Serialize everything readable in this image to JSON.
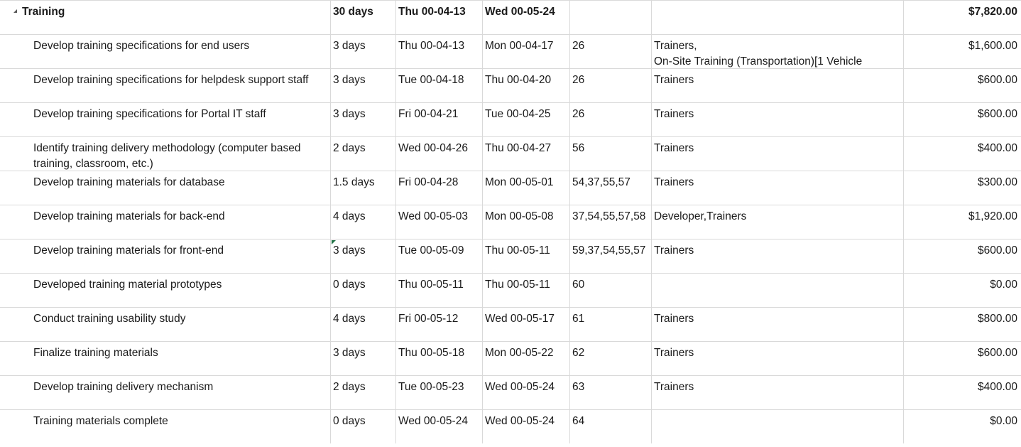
{
  "summary": {
    "name": "Training",
    "duration": "30 days",
    "start": "Thu 00-04-13",
    "finish": "Wed 00-05-24",
    "predecessors": "",
    "resources": [],
    "cost": "$7,820.00"
  },
  "tasks": [
    {
      "name": "Develop training specifications for end users",
      "duration": "3 days",
      "start": "Thu 00-04-13",
      "finish": "Mon 00-04-17",
      "predecessors": "26",
      "resources": [
        "Trainers,",
        "On-Site Training (Transportation)[1 Vehicle"
      ],
      "cost": "$1,600.00"
    },
    {
      "name": "Develop training specifications for helpdesk support staff",
      "duration": "3 days",
      "start": "Tue 00-04-18",
      "finish": "Thu 00-04-20",
      "predecessors": "26",
      "resources": [
        "Trainers"
      ],
      "cost": "$600.00"
    },
    {
      "name": "Develop training specifications for Portal IT staff",
      "duration": "3 days",
      "start": "Fri 00-04-21",
      "finish": "Tue 00-04-25",
      "predecessors": "26",
      "resources": [
        "Trainers"
      ],
      "cost": "$600.00"
    },
    {
      "name": "Identify training delivery methodology (computer based training, classroom, etc.)",
      "duration": "2 days",
      "start": "Wed 00-04-26",
      "finish": "Thu 00-04-27",
      "predecessors": "56",
      "resources": [
        "Trainers"
      ],
      "cost": "$400.00"
    },
    {
      "name": "Develop training materials for database",
      "duration": "1.5 days",
      "start": "Fri 00-04-28",
      "finish": "Mon 00-05-01",
      "predecessors": "54,37,55,57",
      "resources": [
        "Trainers"
      ],
      "cost": "$300.00"
    },
    {
      "name": "Develop training materials for back-end",
      "duration": "4 days",
      "start": "Wed 00-05-03",
      "finish": "Mon 00-05-08",
      "predecessors": "37,54,55,57,58",
      "resources": [
        "Developer,Trainers"
      ],
      "cost": "$1,920.00"
    },
    {
      "name": "Develop training materials for front-end",
      "duration": "3 days",
      "start": "Tue 00-05-09",
      "finish": "Thu 00-05-11",
      "predecessors": "59,37,54,55,57",
      "resources": [
        "Trainers"
      ],
      "cost": "$600.00",
      "edited_marker": true
    },
    {
      "name": "Developed training material prototypes",
      "duration": "0 days",
      "start": "Thu 00-05-11",
      "finish": "Thu 00-05-11",
      "predecessors": "60",
      "resources": [],
      "cost": "$0.00"
    },
    {
      "name": "Conduct training usability study",
      "duration": "4 days",
      "start": "Fri 00-05-12",
      "finish": "Wed 00-05-17",
      "predecessors": "61",
      "resources": [
        "Trainers"
      ],
      "cost": "$800.00"
    },
    {
      "name": "Finalize training materials",
      "duration": "3 days",
      "start": "Thu 00-05-18",
      "finish": "Mon 00-05-22",
      "predecessors": "62",
      "resources": [
        "Trainers"
      ],
      "cost": "$600.00"
    },
    {
      "name": "Develop training delivery mechanism",
      "duration": "2 days",
      "start": "Tue 00-05-23",
      "finish": "Wed 00-05-24",
      "predecessors": "63",
      "resources": [
        "Trainers"
      ],
      "cost": "$400.00"
    },
    {
      "name": "Training materials complete",
      "duration": "0 days",
      "start": "Wed 00-05-24",
      "finish": "Wed 00-05-24",
      "predecessors": "64",
      "resources": [],
      "cost": "$0.00"
    }
  ],
  "colors": {
    "gridline": "#d9d9d9",
    "text": "#1a1a1a",
    "edit_marker": "#217346"
  }
}
